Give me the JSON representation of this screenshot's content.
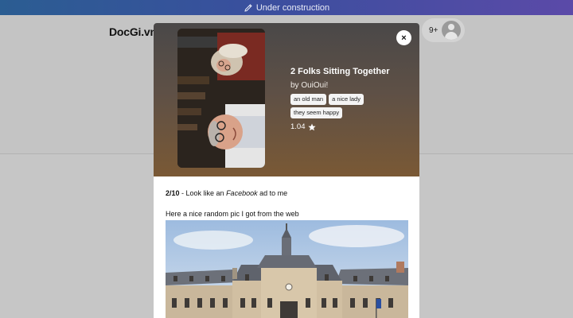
{
  "banner": {
    "text": "Under construction",
    "icon": "pencil-icon"
  },
  "header": {
    "logo": "DocGi.vn",
    "notification_count": "9+",
    "avatar_icon": "user-avatar-icon"
  },
  "modal": {
    "close_label": "×",
    "title": "2 Folks Sitting Together",
    "author": "by OuiOui!",
    "tags": [
      "an old man",
      "a nice lady",
      "they seem happy"
    ],
    "rating": "1.04",
    "rating_icon": "star-icon",
    "review": {
      "score": "2/10",
      "text_before": " - Look like an ",
      "emphasis": "Facebook",
      "text_after": " ad to me"
    },
    "note": "Here a nice random pic I got from the web"
  },
  "colors": {
    "banner_start": "#2b5d92",
    "banner_end": "#5b4aa8",
    "overlay": "#c6c6c6",
    "modal_head_top": "#4a4848",
    "modal_head_bottom": "#7a5935"
  }
}
